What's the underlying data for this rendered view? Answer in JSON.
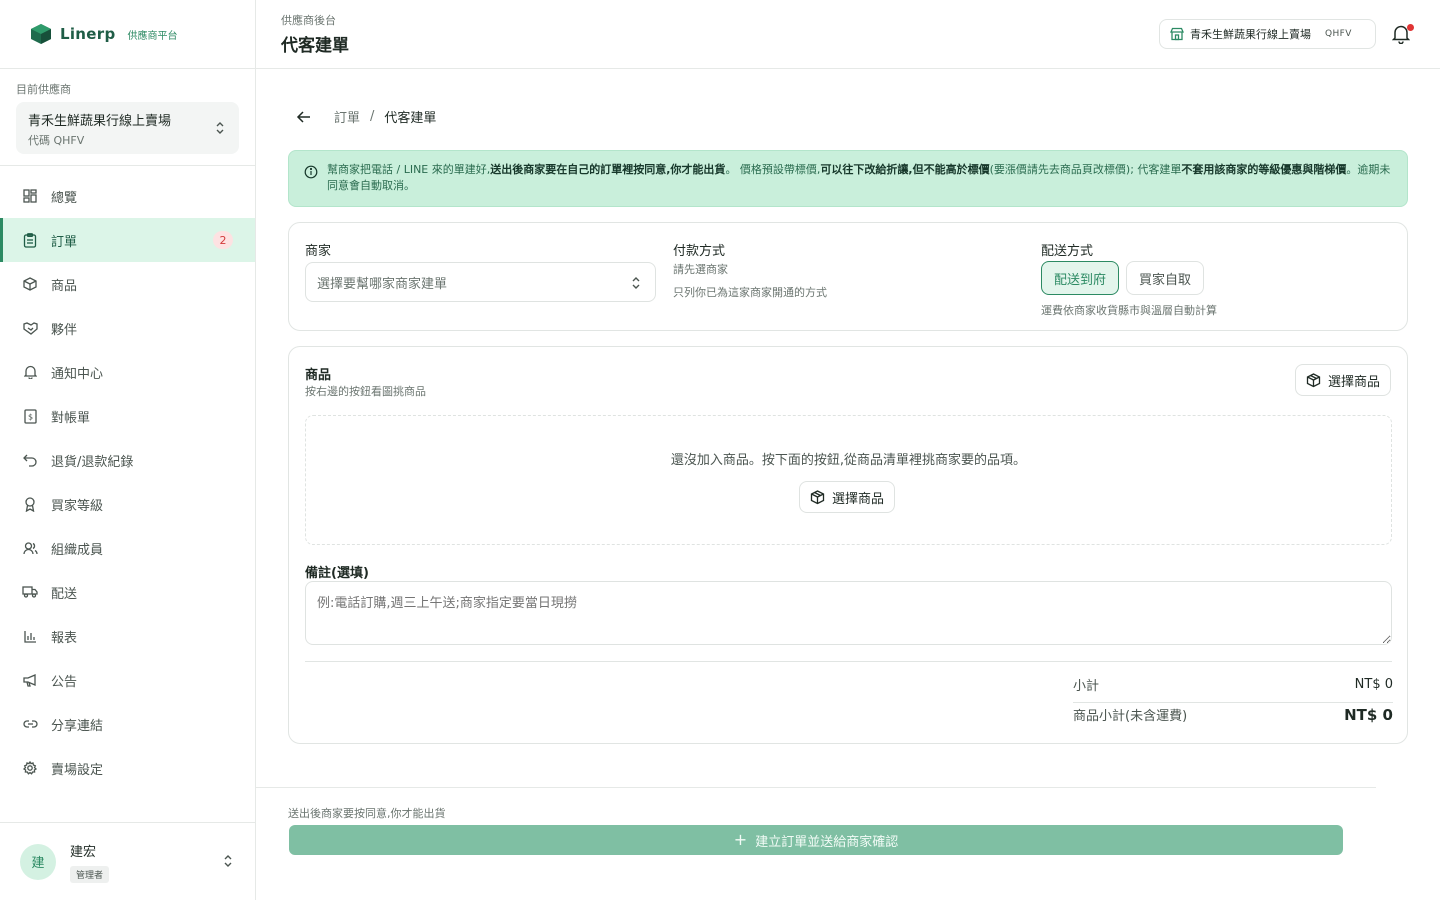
{
  "brand": {
    "name": "Linerp",
    "sub": "供應商平台"
  },
  "vendor": {
    "label": "目前供應商",
    "name": "青禾生鮮蔬果行線上賣場",
    "code": "代碼 QHFV"
  },
  "nav": [
    {
      "label": "總覽",
      "icon": "dashboard-icon"
    },
    {
      "label": "訂單",
      "icon": "clipboard-icon",
      "badge": "2",
      "active": true
    },
    {
      "label": "商品",
      "icon": "box-icon"
    },
    {
      "label": "夥伴",
      "icon": "handshake-icon"
    },
    {
      "label": "通知中心",
      "icon": "bell-icon"
    },
    {
      "label": "對帳單",
      "icon": "receipt-icon"
    },
    {
      "label": "退貨/退款紀錄",
      "icon": "undo-icon"
    },
    {
      "label": "買家等級",
      "icon": "award-icon"
    },
    {
      "label": "組織成員",
      "icon": "users-icon"
    },
    {
      "label": "配送",
      "icon": "truck-icon"
    },
    {
      "label": "報表",
      "icon": "bar-chart-icon"
    },
    {
      "label": "公告",
      "icon": "megaphone-icon"
    },
    {
      "label": "分享連結",
      "icon": "link-icon"
    },
    {
      "label": "賣場設定",
      "icon": "gear-icon"
    }
  ],
  "user": {
    "initial": "建",
    "name": "建宏",
    "role": "管理者"
  },
  "header": {
    "sub": "供應商後台",
    "title": "代客建單",
    "store_name": "青禾生鮮蔬果行線上賣場",
    "store_code": "QHFV"
  },
  "breadcrumb": {
    "parent": "訂單",
    "sep": "/",
    "current": "代客建單"
  },
  "notice": {
    "p1": "幫商家把電話 / LINE 來的單建好,",
    "b1": "送出後商家要在自己的訂單裡按同意,你才能出貨",
    "p2": "。 價格預設帶標價,",
    "b2": "可以往下改給折讓,但不能高於標價",
    "p3": "(要漲價請先去商品頁改標價); 代客建單",
    "b3": "不套用該商家的等級優惠與階梯價",
    "p4": "。逾期未同意會自動取消。"
  },
  "order_form": {
    "merchant_label": "商家",
    "merchant_placeholder": "選擇要幫哪家商家建單",
    "payment_label": "付款方式",
    "payment_hint1": "請先選商家",
    "payment_hint2": "只列你已為這家商家開通的方式",
    "shipping_label": "配送方式",
    "shipping_options": [
      "配送到府",
      "買家自取"
    ],
    "shipping_selected": "配送到府",
    "shipping_hint": "運費依商家收貨縣市與溫層自動計算"
  },
  "products": {
    "title": "商品",
    "subtitle": "按右邊的按鈕看圖挑商品",
    "pick_button": "選擇商品",
    "empty_text": "還沒加入商品。按下面的按鈕,從商品清單裡挑商家要的品項。",
    "note_label": "備註(選填)",
    "note_placeholder": "例:電話訂購,週三上午送;商家指定要當日現撈"
  },
  "summary": {
    "subtotal_label": "小計",
    "subtotal_value": "NT$ 0",
    "items_subtotal_label": "商品小計(未含運費)",
    "items_subtotal_value": "NT$ 0"
  },
  "footer": {
    "note": "送出後商家要按同意,你才能出貨",
    "submit": "建立訂單並送給商家確認"
  },
  "colors": {
    "accent": "#2c8a63",
    "notice_bg": "#c9efdb",
    "submit_bg": "#7fbfa3",
    "badge_bg": "#fde2e2",
    "badge_text": "#d23b3b"
  }
}
